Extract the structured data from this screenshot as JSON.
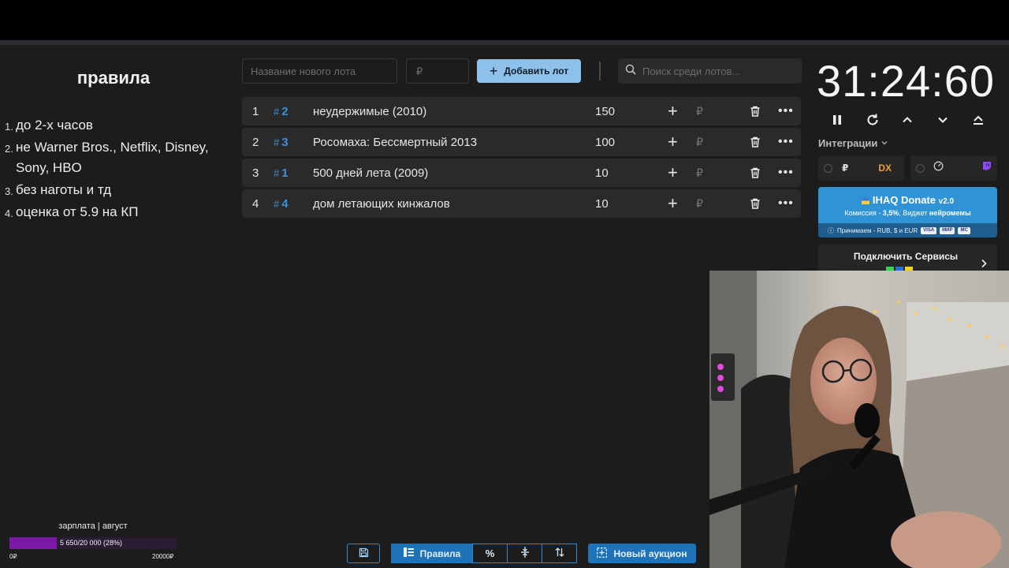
{
  "rules": {
    "title": "правила",
    "items": [
      {
        "num": "1.",
        "text": "до 2-х часов"
      },
      {
        "num": "2.",
        "text": "не Warner Bros., Netflix, Disney, Sony, HBO"
      },
      {
        "num": "3.",
        "text": "без наготы и тд"
      },
      {
        "num": "4.",
        "text": "оценка от 5.9 на КП"
      }
    ]
  },
  "controls": {
    "lot_name_placeholder": "Название нового лота",
    "price_placeholder": "₽",
    "add_button": "Добавить лот",
    "search_placeholder": "Поиск среди лотов..."
  },
  "lots": [
    {
      "index": "1",
      "id": "2",
      "name": "неудержимые (2010)",
      "amount": "150",
      "currency": "₽"
    },
    {
      "index": "2",
      "id": "3",
      "name": "Росомаха: Бессмертный 2013",
      "amount": "100",
      "currency": "₽"
    },
    {
      "index": "3",
      "id": "1",
      "name": "500 дней лета (2009)",
      "amount": "10",
      "currency": "₽"
    },
    {
      "index": "4",
      "id": "4",
      "name": "дом летающих кинжалов",
      "amount": "10",
      "currency": "₽"
    }
  ],
  "timer": {
    "display": "31:24:60"
  },
  "integrations": {
    "label": "Интеграции",
    "ruble_symbol": "₽",
    "dx_label": "DX"
  },
  "donate": {
    "title": "IHAQ Donate",
    "version": "v2.0",
    "subtitle_prefix": "Комиссия - ",
    "subtitle_commission": "3,5%",
    "subtitle_mid": ", Виджет ",
    "subtitle_widget": "нейромемы",
    "accepts": "Принимаем - RUB, $ и EUR",
    "payment_badges": [
      "VISA",
      "МИР",
      "MC"
    ]
  },
  "services": {
    "label": "Подключить Сервисы"
  },
  "salary": {
    "label": "зарплата | август",
    "progress_text": "5 650/20 000 (28%)",
    "current": 5650,
    "goal": 20000,
    "percent": 28,
    "min_label": "0₽",
    "max_label": "20000₽"
  },
  "toolbar": {
    "rules_button": "Правила",
    "percent_label": "%",
    "new_auction_button": "Новый аукцион"
  },
  "colors": {
    "accent_blue": "#2f93d6",
    "lot_hash_blue": "#3d8fd8",
    "add_button_bg": "#8ec1ea",
    "salary_fill": "#7c18a8",
    "background": "#1c1c1c"
  },
  "icons": {
    "pause": "pause-icon",
    "restart": "restart-icon",
    "up": "chevron-up-icon",
    "down": "chevron-down-icon",
    "collapse": "collapse-icon",
    "search": "search-icon",
    "trash": "trash-icon",
    "save": "save-icon",
    "twitch": "twitch-icon"
  }
}
